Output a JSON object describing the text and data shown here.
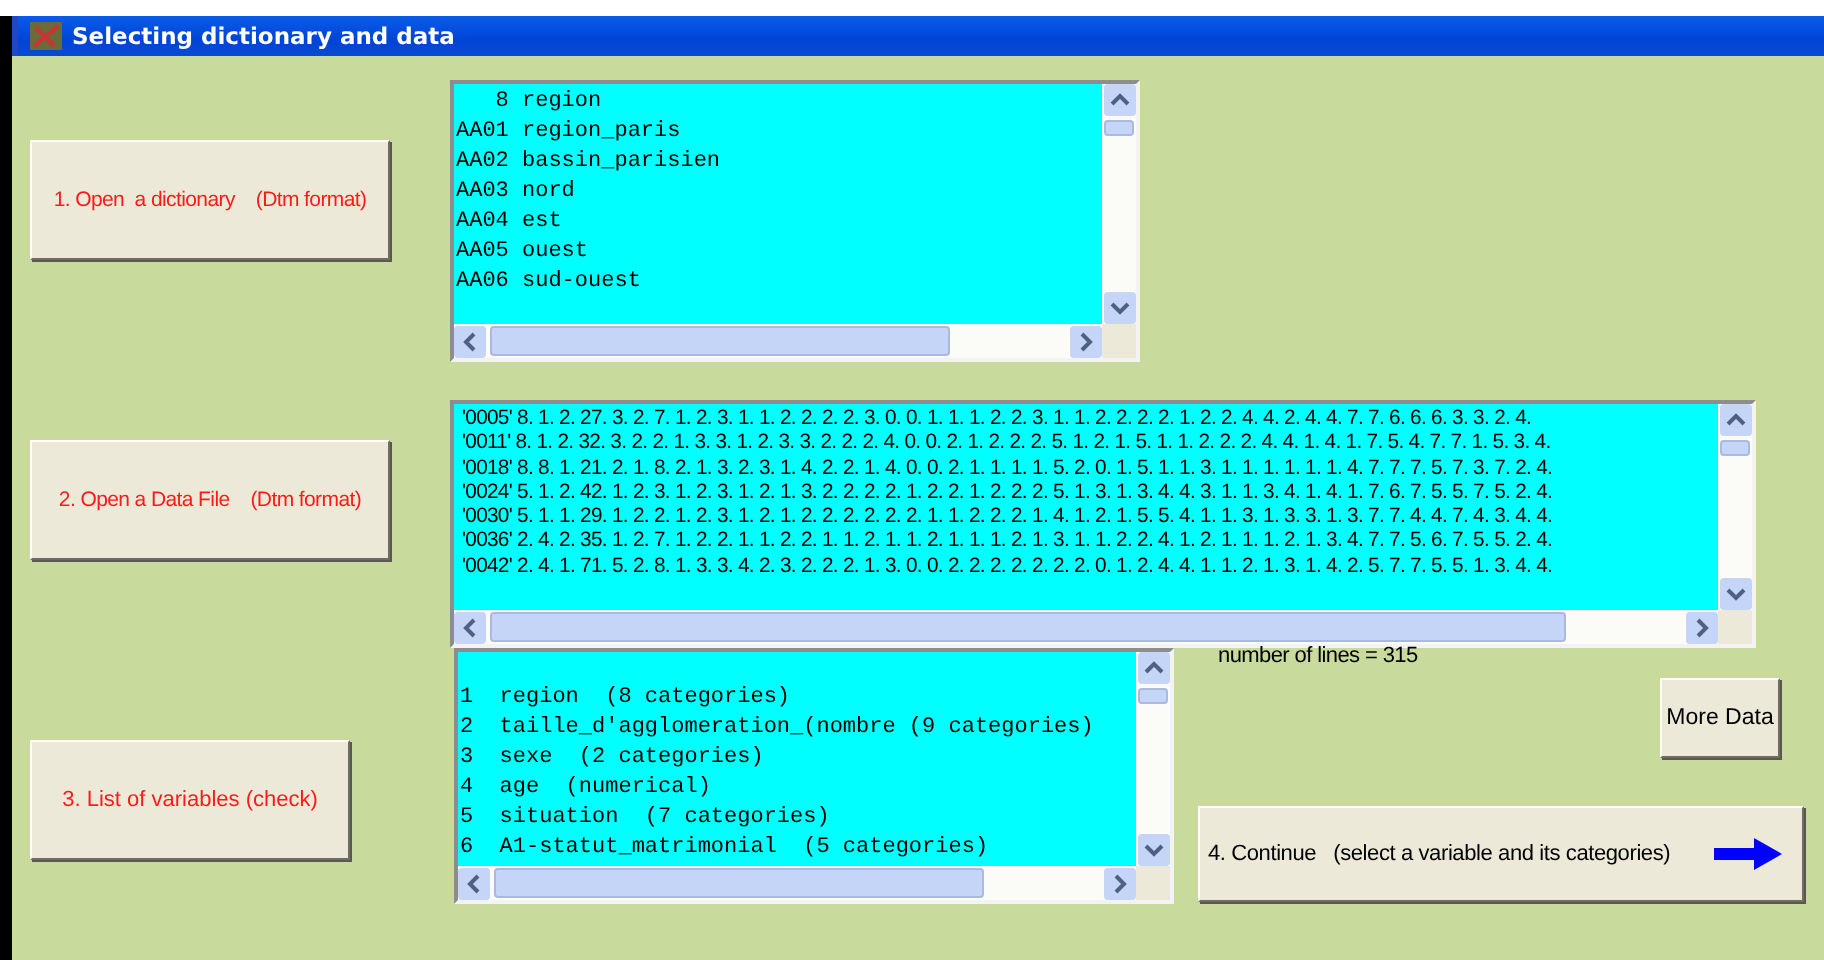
{
  "window": {
    "title": "Selecting dictionary and data"
  },
  "dictionary": {
    "button": "1. Open  a dictionary    (Dtm format)",
    "lines": [
      "   8 region",
      "AA01 region_paris",
      "AA02 bassin_parisien",
      "AA03 nord",
      "AA04 est",
      "AA05 ouest",
      "AA06 sud-ouest"
    ]
  },
  "data_file": {
    "button": "2. Open a Data File    (Dtm format)",
    "lines": [
      "'0005' 8. 1. 2. 27. 3. 2. 7. 1. 2. 3. 1. 1. 2. 2. 2. 2. 3. 0. 0. 1. 1. 1. 2. 2. 3. 1. 1. 2. 2. 2. 2. 1. 2. 2. 4. 4. 2. 4. 4. 7. 7. 6. 6. 6. 3. 3. 2. 4.",
      "'0011' 8. 1. 2. 32. 3. 2. 2. 1. 3. 3. 1. 2. 3. 3. 2. 2. 2. 4. 0. 0. 2. 1. 2. 2. 2. 5. 1. 2. 1. 5. 1. 1. 2. 2. 2. 4. 4. 1. 4. 1. 7. 5. 4. 7. 7. 1. 5. 3. 4.",
      "'0018' 8. 8. 1. 21. 2. 1. 8. 2. 1. 3. 2. 3. 1. 4. 2. 2. 1. 4. 0. 0. 2. 1. 1. 1. 1. 5. 2. 0. 1. 5. 1. 1. 3. 1. 1. 1. 1. 1. 1. 4. 7. 7. 7. 5. 7. 3. 7. 2. 4.",
      "'0024' 5. 1. 2. 42. 1. 2. 3. 1. 2. 3. 1. 2. 1. 3. 2. 2. 2. 2. 1. 2. 2. 1. 2. 2. 2. 5. 1. 3. 1. 3. 4. 4. 3. 1. 1. 3. 4. 1. 4. 1. 7. 6. 7. 5. 5. 7. 5. 2. 4.",
      "'0030' 5. 1. 1. 29. 1. 2. 2. 1. 2. 3. 1. 2. 1. 2. 2. 2. 2. 2. 2. 1. 1. 2. 2. 2. 1. 4. 1. 2. 1. 5. 5. 4. 1. 1. 3. 1. 3. 3. 1. 3. 7. 7. 4. 4. 7. 4. 3. 4. 4.",
      "'0036' 2. 4. 2. 35. 1. 2. 7. 1. 2. 2. 1. 1. 2. 2. 1. 1. 2. 1. 1. 2. 1. 1. 1. 2. 1. 3. 1. 1. 2. 2. 4. 1. 2. 1. 1. 1. 2. 1. 3. 4. 7. 7. 5. 6. 7. 5. 5. 2. 4.",
      "'0042' 2. 4. 1. 71. 5. 2. 8. 1. 3. 3. 4. 2. 3. 2. 2. 2. 1. 3. 0. 0. 2. 2. 2. 2. 2. 2. 2. 0. 1. 2. 4. 4. 1. 1. 2. 1. 3. 1. 4. 2. 5. 7. 7. 5. 5. 1. 3. 4. 4."
    ]
  },
  "variables": {
    "button": "3. List of variables (check)",
    "lines": [
      "1  region  (8 categories)",
      "2  taille_d'agglomeration_(nombre (9 categories)",
      "3  sexe  (2 categories)",
      "4  age  (numerical)",
      "5  situation  (7 categories)",
      "6  A1-statut_matrimonial  (5 categories)"
    ]
  },
  "number_of_lines": "number of lines =  315",
  "more_data_button": "More Data",
  "continue_button": "4. Continue   (select a variable and its categories)"
}
